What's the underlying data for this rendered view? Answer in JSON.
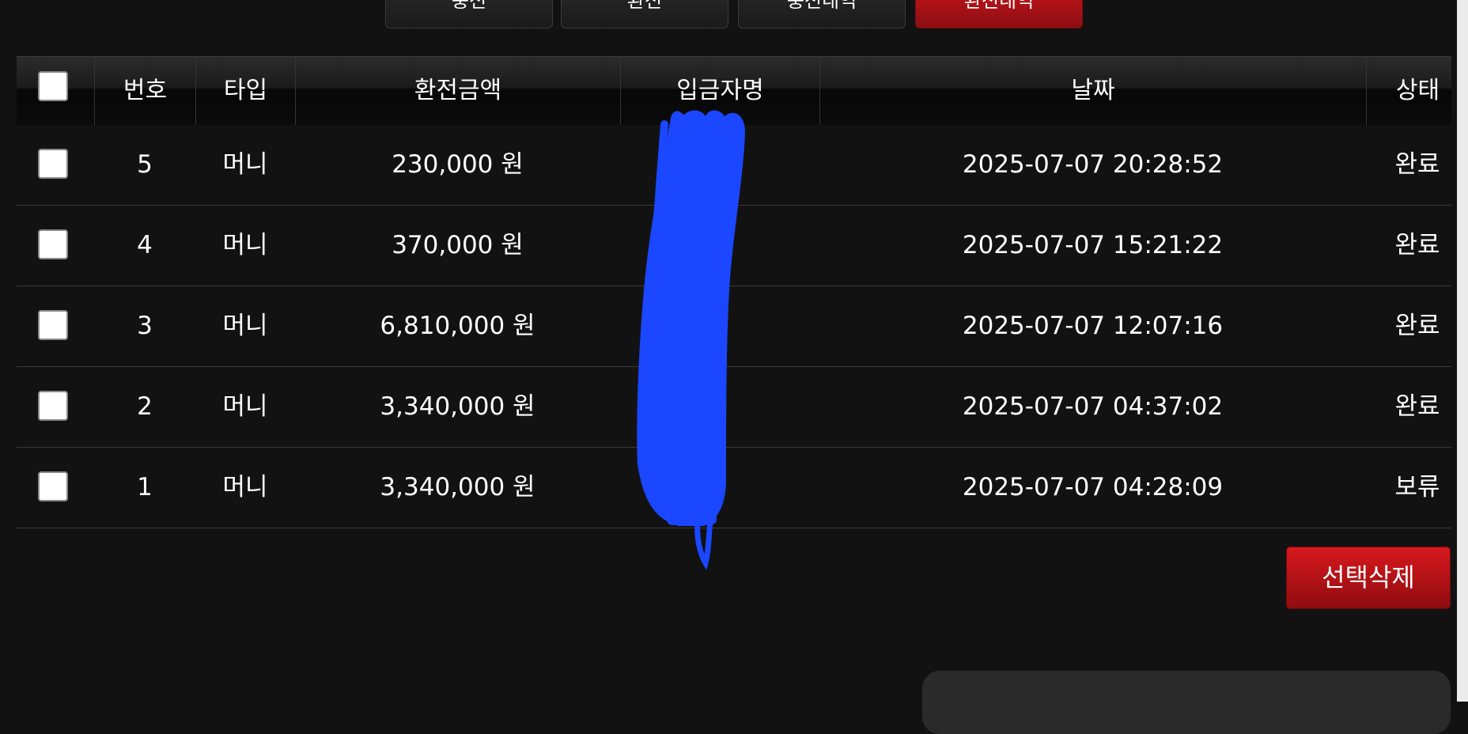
{
  "tabs": [
    {
      "label": "충전"
    },
    {
      "label": "환전"
    },
    {
      "label": "충전내역"
    },
    {
      "label": "환전내역"
    }
  ],
  "table": {
    "headers": {
      "number": "번호",
      "type": "타입",
      "amount": "환전금액",
      "depositor": "입금자명",
      "date": "날짜",
      "status": "상태"
    },
    "rows": [
      {
        "number": "5",
        "type": "머니",
        "amount": "230,000 원",
        "depositor": "",
        "date": "2025-07-07 20:28:52",
        "status": "완료"
      },
      {
        "number": "4",
        "type": "머니",
        "amount": "370,000 원",
        "depositor": "",
        "date": "2025-07-07 15:21:22",
        "status": "완료"
      },
      {
        "number": "3",
        "type": "머니",
        "amount": "6,810,000 원",
        "depositor": "",
        "date": "2025-07-07 12:07:16",
        "status": "완료"
      },
      {
        "number": "2",
        "type": "머니",
        "amount": "3,340,000 원",
        "depositor": "",
        "date": "2025-07-07 04:37:02",
        "status": "완료"
      },
      {
        "number": "1",
        "type": "머니",
        "amount": "3,340,000 원",
        "depositor": "",
        "date": "2025-07-07 04:28:09",
        "status": "보류"
      }
    ]
  },
  "actions": {
    "delete_selected_label": "선택삭제"
  },
  "colors": {
    "background": "#121212",
    "accent_red": "#c8161b",
    "redaction_blue": "#1a47ff"
  }
}
